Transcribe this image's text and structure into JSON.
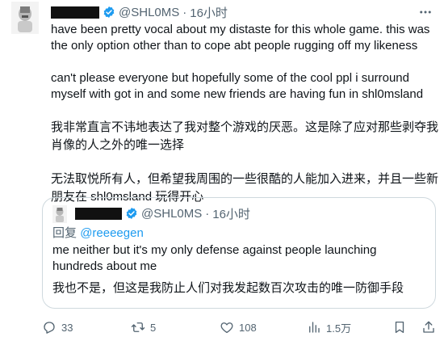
{
  "tweet": {
    "handle": "@SHL0MS",
    "separator": "·",
    "time": "16小时",
    "paragraphs": [
      "have been pretty vocal about my distaste for this whole game. this was the only option other than to cope abt people rugging off my likeness",
      "can't please everyone but hopefully some of the cool ppl i surround myself with got in and some new friends are having fun in shl0msland",
      "我非常直言不讳地表达了我对整个游戏的厌恶。这是除了应对那些剥夺我肖像的人之外的唯一选择",
      "无法取悦所有人，但希望我周围的一些很酷的人能加入进来，并且一些新朋友在 shl0msland 玩得开心"
    ],
    "icons": {
      "verified": "verified-badge-icon",
      "more": "more-options-icon"
    }
  },
  "quote": {
    "handle": "@SHL0MS",
    "separator": "·",
    "time": "16小时",
    "reply_prefix": "回复",
    "reply_mention": "@reeeegen",
    "text": "me neither but it's my only defense against people launching hundreds about me",
    "translation": "我也不是，但这是我防止人们对我发起数百次攻击的唯一防御手段"
  },
  "actions": {
    "replies": "33",
    "reposts": "5",
    "likes": "108",
    "views": "1.5万"
  },
  "colors": {
    "accent": "#1d9bf0",
    "secondary_text": "#536471",
    "border": "#cfd9de"
  }
}
